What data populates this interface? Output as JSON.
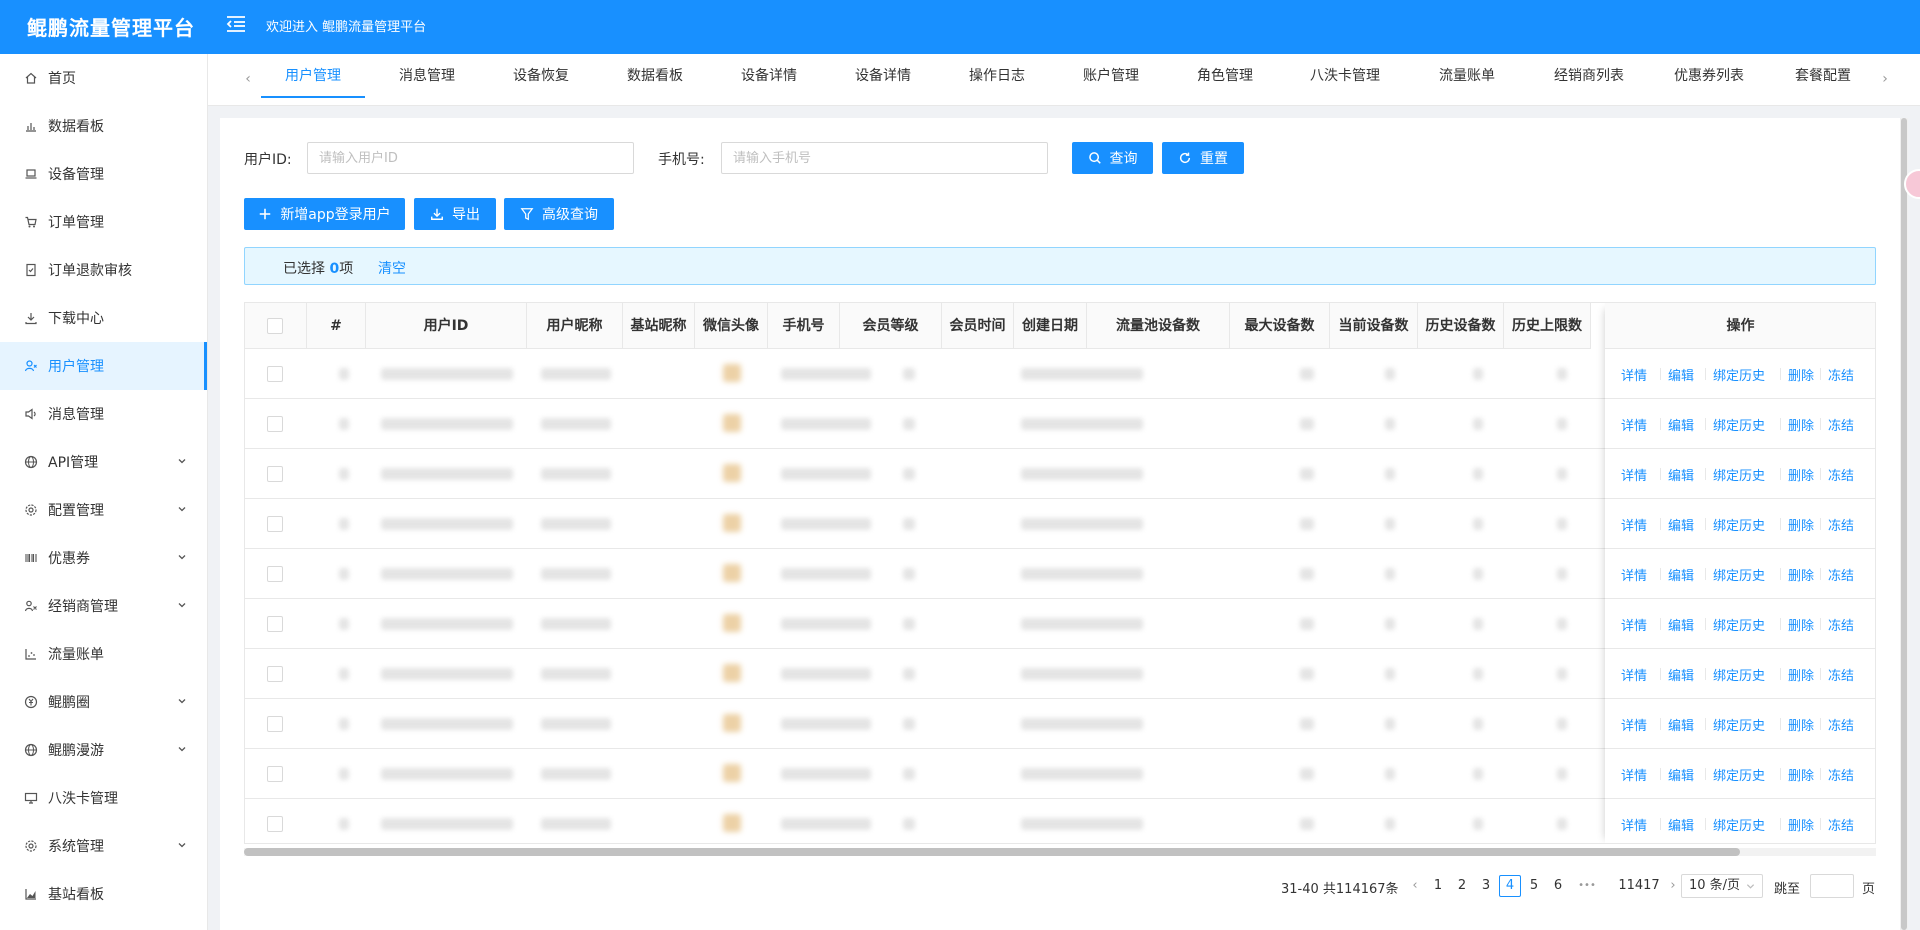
{
  "header": {
    "title": "鲲鹏流量管理平台",
    "welcome": "欢迎进入 鲲鹏流量管理平台"
  },
  "sidebar": {
    "items": [
      {
        "label": "首页",
        "icon": "home-icon"
      },
      {
        "label": "数据看板",
        "icon": "bar-chart-icon"
      },
      {
        "label": "设备管理",
        "icon": "laptop-icon"
      },
      {
        "label": "订单管理",
        "icon": "cart-icon"
      },
      {
        "label": "订单退款审核",
        "icon": "audit-icon"
      },
      {
        "label": "下载中心",
        "icon": "download-icon"
      },
      {
        "label": "用户管理",
        "icon": "user-icon",
        "active": true
      },
      {
        "label": "消息管理",
        "icon": "sound-icon"
      },
      {
        "label": "API管理",
        "icon": "global-icon",
        "expandable": true
      },
      {
        "label": "配置管理",
        "icon": "setting-icon",
        "expandable": true
      },
      {
        "label": "优惠券",
        "icon": "barcode-icon",
        "expandable": true
      },
      {
        "label": "经销商管理",
        "icon": "team-icon",
        "expandable": true
      },
      {
        "label": "流量账单",
        "icon": "dot-chart-icon"
      },
      {
        "label": "鲲鹏圈",
        "icon": "yuan-icon",
        "expandable": true
      },
      {
        "label": "鲲鹏漫游",
        "icon": "globe-icon",
        "expandable": true
      },
      {
        "label": "八泆卡管理",
        "icon": "desktop-icon"
      },
      {
        "label": "系统管理",
        "icon": "system-setting-icon",
        "expandable": true
      },
      {
        "label": "基站看板",
        "icon": "area-chart-icon"
      }
    ]
  },
  "tabs": [
    {
      "label": "用户管理",
      "active": true
    },
    {
      "label": "消息管理"
    },
    {
      "label": "设备恢复"
    },
    {
      "label": "数据看板"
    },
    {
      "label": "设备详情"
    },
    {
      "label": "设备详情"
    },
    {
      "label": "操作日志"
    },
    {
      "label": "账户管理"
    },
    {
      "label": "角色管理"
    },
    {
      "label": "八泆卡管理"
    },
    {
      "label": "流量账单"
    },
    {
      "label": "经销商列表"
    },
    {
      "label": "优惠券列表"
    },
    {
      "label": "套餐配置"
    }
  ],
  "filters": {
    "user_id_label": "用户ID:",
    "user_id_placeholder": "请输入用户ID",
    "phone_label": "手机号:",
    "phone_placeholder": "请输入手机号",
    "query_label": "查询",
    "reset_label": "重置"
  },
  "toolbar": {
    "add_label": "新增app登录用户",
    "export_label": "导出",
    "advanced_label": "高级查询"
  },
  "selection": {
    "prefix": "已选择",
    "count": "0",
    "suffix": "项",
    "clear_label": "清空"
  },
  "table": {
    "columns": [
      "#",
      "用户ID",
      "用户昵称",
      "基站昵称",
      "微信头像",
      "手机号",
      "会员等级",
      "会员时间",
      "创建日期",
      "流量池设备数",
      "最大设备数",
      "当前设备数",
      "历史设备数",
      "历史上限数",
      "操作"
    ],
    "row_actions": [
      "详情",
      "编辑",
      "绑定历史",
      "删除",
      "冻结"
    ],
    "row_count": 10
  },
  "pagination": {
    "summary": "31-40 共114167条",
    "pages": [
      "1",
      "2",
      "3",
      "4",
      "5",
      "6"
    ],
    "current": "4",
    "ellipsis": "•••",
    "last": "11417",
    "page_size": "10 条/页",
    "jump_label": "跳至",
    "page_suffix": "页"
  },
  "colors": {
    "primary": "#1890ff",
    "header_bg": "#1890ff",
    "alert_bg": "#e6f7ff"
  }
}
